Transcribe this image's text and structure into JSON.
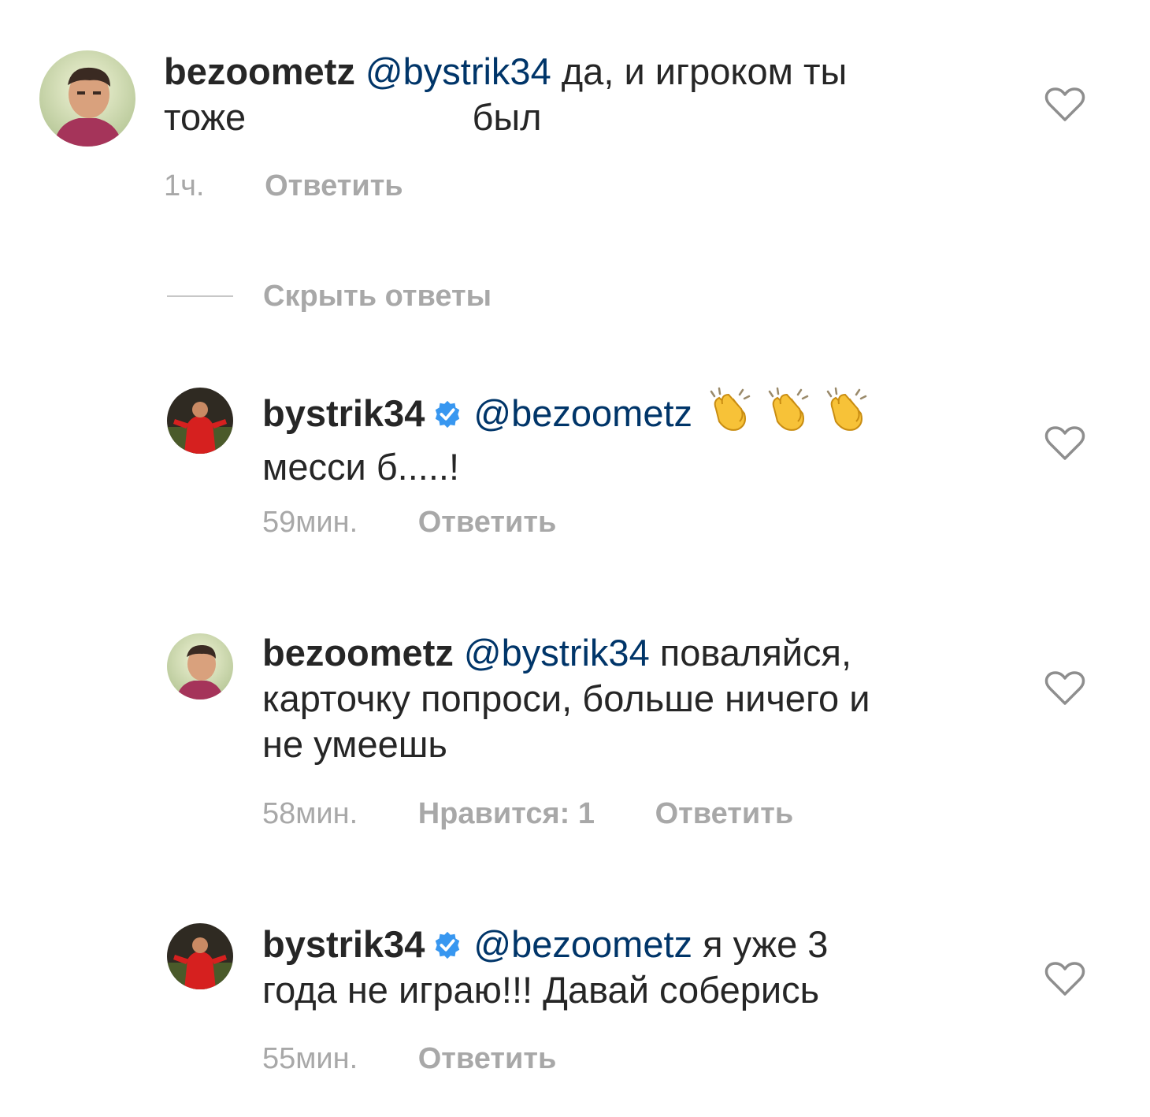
{
  "comments": [
    {
      "username": "bezoometz",
      "verified": false,
      "mention": "@bystrik34",
      "text_line1": " да, и игроком ты",
      "text_line2": "тоже                      был",
      "time": "1ч.",
      "likes": "",
      "reply_label": "Ответить",
      "avatar_icon": "user-avatar-photo"
    },
    {
      "username": "bystrik34",
      "verified": true,
      "mention": "@bezoometz",
      "emojis": [
        "clapping-hands",
        "clapping-hands",
        "clapping-hands"
      ],
      "text_line2": "месси б.....!",
      "time": "59мин.",
      "likes": "",
      "reply_label": "Ответить",
      "avatar_icon": "football-player-photo"
    },
    {
      "username": "bezoometz",
      "verified": false,
      "mention": "@bystrik34",
      "text_line1": " поваляйся,",
      "text_line2": "карточку попроси, больше ничего и",
      "text_line3": "не умеешь",
      "time": "58мин.",
      "likes": "Нравится: 1",
      "reply_label": "Ответить",
      "avatar_icon": "user-avatar-photo"
    },
    {
      "username": "bystrik34",
      "verified": true,
      "mention": "@bezoometz",
      "text_line1": " я уже 3",
      "text_line2": "года не играю!!! Давай соберись",
      "time": "55мин.",
      "likes": "",
      "reply_label": "Ответить",
      "avatar_icon": "football-player-photo"
    }
  ],
  "hide_replies_label": "Скрыть ответы",
  "colors": {
    "text": "#262626",
    "mention": "#003569",
    "meta": "#a8a8a8",
    "verified": "#3897f0",
    "heart_outline": "#8e8e8e"
  }
}
